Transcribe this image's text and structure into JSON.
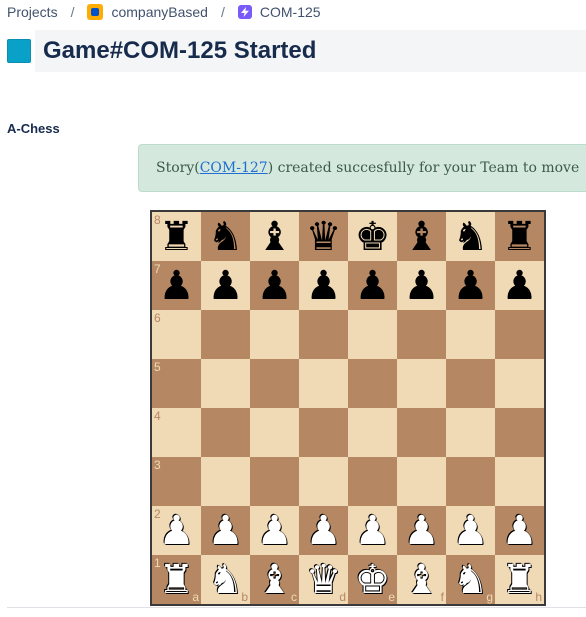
{
  "breadcrumb": {
    "root": "Projects",
    "project": "companyBased",
    "issue": "COM-125",
    "separator": "/"
  },
  "title": "Game#COM-125 Started",
  "section_label": "A-Chess",
  "alert": {
    "prefix": "Story(",
    "link": "COM-127",
    "suffix": ") created succesfully for your Team to move"
  },
  "board": {
    "ranks": [
      "8",
      "7",
      "6",
      "5",
      "4",
      "3",
      "2",
      "1"
    ],
    "files": [
      "a",
      "b",
      "c",
      "d",
      "e",
      "f",
      "g",
      "h"
    ],
    "position": [
      [
        "br",
        "bn",
        "bb",
        "bq",
        "bk",
        "bb",
        "bn",
        "br"
      ],
      [
        "bp",
        "bp",
        "bp",
        "bp",
        "bp",
        "bp",
        "bp",
        "bp"
      ],
      [
        "",
        "",
        "",
        "",
        "",
        "",
        "",
        ""
      ],
      [
        "",
        "",
        "",
        "",
        "",
        "",
        "",
        ""
      ],
      [
        "",
        "",
        "",
        "",
        "",
        "",
        "",
        ""
      ],
      [
        "",
        "",
        "",
        "",
        "",
        "",
        "",
        ""
      ],
      [
        "wp",
        "wp",
        "wp",
        "wp",
        "wp",
        "wp",
        "wp",
        "wp"
      ],
      [
        "wr",
        "wn",
        "wb",
        "wq",
        "wk",
        "wb",
        "wn",
        "wr"
      ]
    ],
    "colors": {
      "light": "#f0d9b5",
      "dark": "#b58863"
    }
  },
  "colors": {
    "title_swatch": "#0aa1c8",
    "alert_bg": "#d4e8de",
    "project_icon": "#ffab00",
    "story_icon": "#7a5af8"
  }
}
